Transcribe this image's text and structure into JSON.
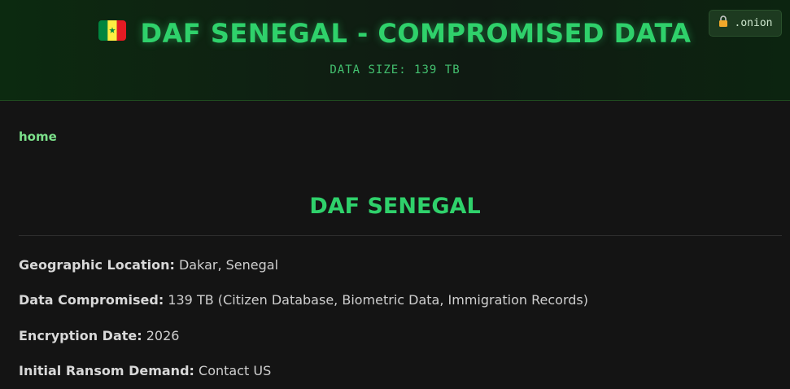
{
  "header": {
    "flag_icon": "senegal-flag-icon",
    "title": "DAF SENEGAL - COMPROMISED DATA",
    "data_size": "DATA SIZE: 139 TB",
    "badge": {
      "icon": "lock-icon",
      "label": ".onion"
    }
  },
  "nav": {
    "home_label": "home"
  },
  "main": {
    "title": "DAF SENEGAL",
    "info": [
      {
        "label": "Geographic Location:",
        "value": "Dakar, Senegal"
      },
      {
        "label": "Data Compromised:",
        "value": "139 TB (Citizen Database, Biometric Data, Immigration Records)"
      },
      {
        "label": "Encryption Date:",
        "value": "2026"
      },
      {
        "label": "Initial Ransom Demand:",
        "value": "Contact US"
      }
    ]
  },
  "colors": {
    "accent": "#2fd16b",
    "background": "#141414",
    "link": "#7be08a"
  }
}
